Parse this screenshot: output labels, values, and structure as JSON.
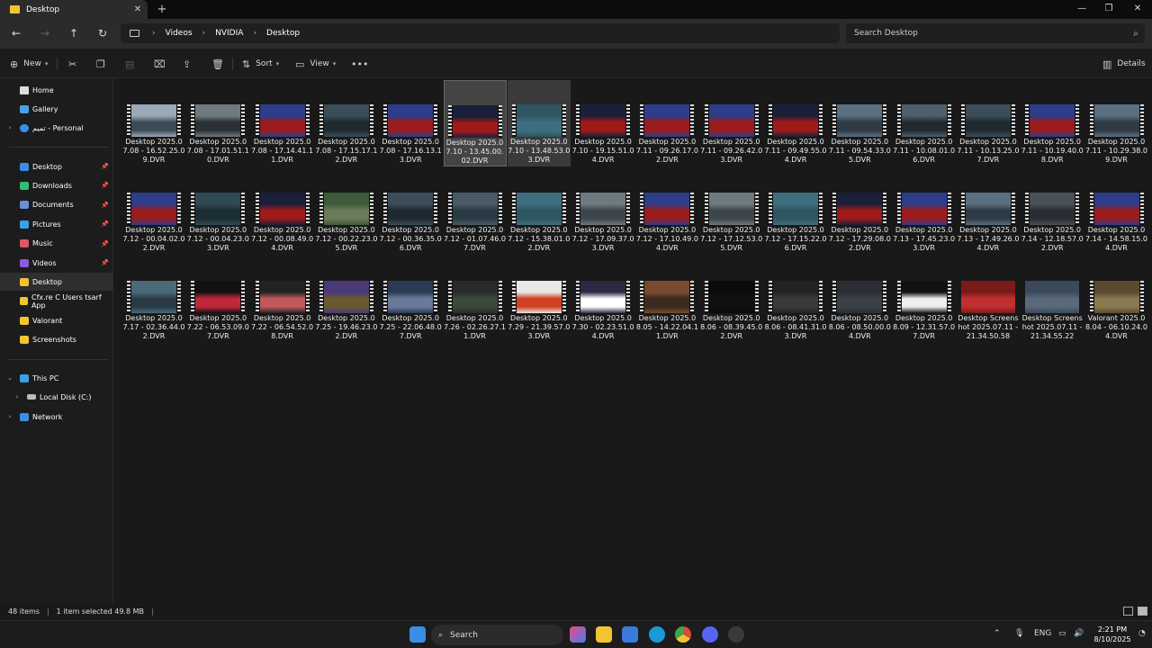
{
  "window": {
    "tab_title": "Desktop",
    "new_tab": "+",
    "close_tab": "✕",
    "minimize": "—",
    "restore": "❐",
    "close": "✕"
  },
  "nav": {
    "back": "←",
    "forward": "→",
    "up": "↑",
    "refresh": "↻",
    "breadcrumbs": [
      "Videos",
      "NVIDIA",
      "Desktop"
    ],
    "search_placeholder": "Search Desktop"
  },
  "toolbar": {
    "new": "New",
    "sort": "Sort",
    "view": "View",
    "more": "•••",
    "details": "Details"
  },
  "sidebar": {
    "home": "Home",
    "gallery": "Gallery",
    "onedrive": "تميم - Personal",
    "quick": [
      {
        "label": "Desktop",
        "pinned": true,
        "color": "#3a8ee6"
      },
      {
        "label": "Downloads",
        "pinned": true,
        "color": "#2fbf71"
      },
      {
        "label": "Documents",
        "pinned": true,
        "color": "#6a8fd9"
      },
      {
        "label": "Pictures",
        "pinned": true,
        "color": "#3aa0e6"
      },
      {
        "label": "Music",
        "pinned": true,
        "color": "#e0556a"
      },
      {
        "label": "Videos",
        "pinned": true,
        "color": "#8a5be0"
      },
      {
        "label": "Desktop",
        "pinned": false,
        "color": "#f4c430"
      },
      {
        "label": "Cfx.re  C  Users tsarf App",
        "pinned": false,
        "color": "#f4c430"
      },
      {
        "label": "Valorant",
        "pinned": false,
        "color": "#f4c430"
      },
      {
        "label": "Screenshots",
        "pinned": false,
        "color": "#f4c430"
      }
    ],
    "this_pc": "This PC",
    "local_disk": "Local Disk (C:)",
    "network": "Network"
  },
  "files": [
    {
      "name": "Desktop 2025.07.08 - 16.52.25.09.DVR",
      "c1": "#9aa9b8",
      "c2": "#3c4b55"
    },
    {
      "name": "Desktop 2025.07.08 - 17.01.51.10.DVR",
      "c1": "#6f7a80",
      "c2": "#2a3034"
    },
    {
      "name": "Desktop 2025.07.08 - 17.14.41.11.DVR",
      "c1": "#2c3d8a",
      "c2": "#9b1c1c"
    },
    {
      "name": "Desktop 2025.07.08 - 17.15.17.12.DVR",
      "c1": "#3b4d58",
      "c2": "#1e2a30"
    },
    {
      "name": "Desktop 2025.07.08 - 17.16.13.13.DVR",
      "c1": "#2c3d8a",
      "c2": "#9b1c1c"
    },
    {
      "name": "Desktop 2025.07.10 - 13.45.00.02.DVR",
      "c1": "#1a1f3a",
      "c2": "#a01a1a",
      "state": "sel"
    },
    {
      "name": "Desktop 2025.07.10 - 13.48.53.03.DVR",
      "c1": "#2f5560",
      "c2": "#3e6f80",
      "state": "hov"
    },
    {
      "name": "Desktop 2025.07.10 - 19.15.51.04.DVR",
      "c1": "#1a1f3a",
      "c2": "#a01a1a"
    },
    {
      "name": "Desktop 2025.07.11 - 09.26.17.02.DVR",
      "c1": "#2c3d8a",
      "c2": "#9b1c1c"
    },
    {
      "name": "Desktop 2025.07.11 - 09.26.42.03.DVR",
      "c1": "#2c3d8a",
      "c2": "#9b1c1c"
    },
    {
      "name": "Desktop 2025.07.11 - 09.49.55.04.DVR",
      "c1": "#1a1f3a",
      "c2": "#a01a1a"
    },
    {
      "name": "Desktop 2025.07.11 - 09.54.33.05.DVR",
      "c1": "#5a6f80",
      "c2": "#2e3a44"
    },
    {
      "name": "Desktop 2025.07.11 - 10.08.01.06.DVR",
      "c1": "#4e5f6a",
      "c2": "#22292e"
    },
    {
      "name": "Desktop 2025.07.11 - 10.13.25.07.DVR",
      "c1": "#3b4d58",
      "c2": "#1e2a30"
    },
    {
      "name": "Desktop 2025.07.11 - 10.19.40.08.DVR",
      "c1": "#2c3d8a",
      "c2": "#9b1c1c"
    },
    {
      "name": "Desktop 2025.07.11 - 10.29.38.09.DVR",
      "c1": "#5a6f80",
      "c2": "#2e3a44"
    },
    {
      "name": "Desktop 2025.07.12 - 00.04.02.02.DVR",
      "c1": "#2c3d8a",
      "c2": "#9b1c1c"
    },
    {
      "name": "Desktop 2025.07.12 - 00.04.23.03.DVR",
      "c1": "#2f4a55",
      "c2": "#1c2c33"
    },
    {
      "name": "Desktop 2025.07.12 - 00.08.49.04.DVR",
      "c1": "#1a1f3a",
      "c2": "#a01a1a"
    },
    {
      "name": "Desktop 2025.07.12 - 00.22.23.05.DVR",
      "c1": "#3e5a3a",
      "c2": "#6a7a5a"
    },
    {
      "name": "Desktop 2025.07.12 - 00.36.35.06.DVR",
      "c1": "#3b4d58",
      "c2": "#1e2a30"
    },
    {
      "name": "Desktop 2025.07.12 - 01.07.46.07.DVR",
      "c1": "#4a5a66",
      "c2": "#2a3a44"
    },
    {
      "name": "Desktop 2025.07.12 - 15.38.01.02.DVR",
      "c1": "#3e6f80",
      "c2": "#2f5560"
    },
    {
      "name": "Desktop 2025.07.12 - 17.09.37.03.DVR",
      "c1": "#6f7a80",
      "c2": "#3c464c"
    },
    {
      "name": "Desktop 2025.07.12 - 17.10.49.04.DVR",
      "c1": "#2c3d8a",
      "c2": "#9b1c1c"
    },
    {
      "name": "Desktop 2025.07.12 - 17.12.53.05.DVR",
      "c1": "#6f7a80",
      "c2": "#3c464c"
    },
    {
      "name": "Desktop 2025.07.12 - 17.15.22.06.DVR",
      "c1": "#3e6f80",
      "c2": "#2f5560"
    },
    {
      "name": "Desktop 2025.07.12 - 17.29.08.02.DVR",
      "c1": "#1a1f3a",
      "c2": "#a01a1a"
    },
    {
      "name": "Desktop 2025.07.13 - 17.45.23.03.DVR",
      "c1": "#2c3d8a",
      "c2": "#9b1c1c"
    },
    {
      "name": "Desktop 2025.07.13 - 17.49.26.04.DVR",
      "c1": "#5a6f80",
      "c2": "#2e3a44"
    },
    {
      "name": "Desktop 2025.07.14 - 12.18.57.02.DVR",
      "c1": "#4a5058",
      "c2": "#2a2e33"
    },
    {
      "name": "Desktop 2025.07.14 - 14.58.15.04.DVR",
      "c1": "#2c3d8a",
      "c2": "#9b1c1c"
    },
    {
      "name": "Desktop 2025.07.17 - 02.36.44.02.DVR",
      "c1": "#4a6a7a",
      "c2": "#2a3a44"
    },
    {
      "name": "Desktop 2025.07.22 - 06.53.09.07.DVR",
      "c1": "#111111",
      "c2": "#c0283a"
    },
    {
      "name": "Desktop 2025.07.22 - 06.54.52.08.DVR",
      "c1": "#222222",
      "c2": "#c05a5a"
    },
    {
      "name": "Desktop 2025.07.25 - 19.46.23.02.DVR",
      "c1": "#4a3a7a",
      "c2": "#6a5a30"
    },
    {
      "name": "Desktop 2025.07.25 - 22.06.48.07.DVR",
      "c1": "#2a3a55",
      "c2": "#6a7a9a"
    },
    {
      "name": "Desktop 2025.07.26 - 02.26.27.11.DVR",
      "c1": "#2a2a2a",
      "c2": "#3a4a3a"
    },
    {
      "name": "Desktop 2025.07.29 - 21.39.57.03.DVR",
      "c1": "#e8e8e8",
      "c2": "#d04020"
    },
    {
      "name": "Desktop 2025.07.30 - 02.23.51.04.DVR",
      "c1": "#2a2a44",
      "c2": "#ffffff"
    },
    {
      "name": "Desktop 2025.08.05 - 14.22.04.11.DVR",
      "c1": "#7a4a30",
      "c2": "#3a2a20"
    },
    {
      "name": "Desktop 2025.08.06 - 08.39.45.02.DVR",
      "c1": "#0a0a0a",
      "c2": "#111111"
    },
    {
      "name": "Desktop 2025.08.06 - 08.41.31.03.DVR",
      "c1": "#222222",
      "c2": "#3a3a3a"
    },
    {
      "name": "Desktop 2025.08.06 - 08.50.00.04.DVR",
      "c1": "#2a2e33",
      "c2": "#3a4046"
    },
    {
      "name": "Desktop 2025.08.09 - 12.31.57.07.DVR",
      "c1": "#111111",
      "c2": "#eeeeee"
    },
    {
      "name": "Desktop Screenshot 2025.07.11 - 21.34.50.58",
      "c1": "#7a1a1a",
      "c2": "#c03030",
      "kind": "image"
    },
    {
      "name": "Desktop Screenshot 2025.07.11 - 21.34.55.22",
      "c1": "#3a4a5a",
      "c2": "#5a6a7a",
      "kind": "image"
    },
    {
      "name": "Valorant 2025.08.04 - 06.10.24.04.DVR",
      "c1": "#5a4a30",
      "c2": "#8a7a50"
    }
  ],
  "status": {
    "items": "48 items",
    "selected": "1 item selected  49.8 MB"
  },
  "taskbar": {
    "search": "Search",
    "lang": "ENG",
    "time": "2:21 PM",
    "date": "8/10/2025"
  }
}
